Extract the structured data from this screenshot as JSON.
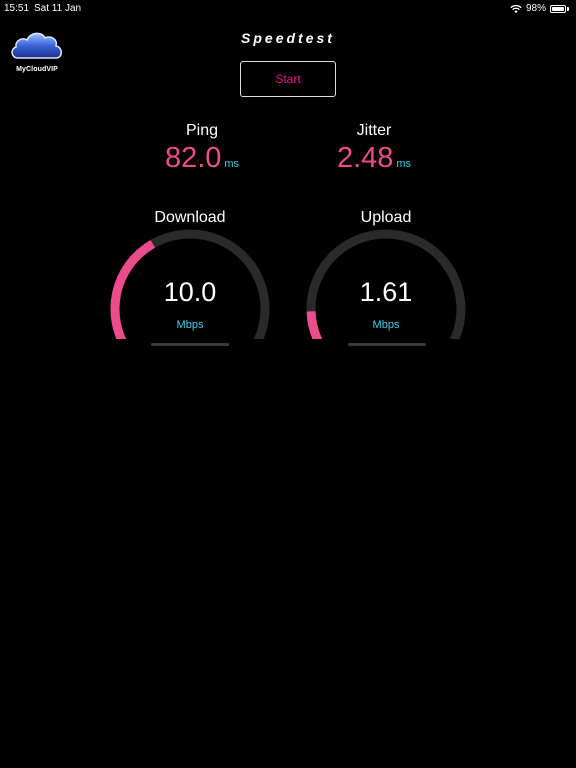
{
  "status_bar": {
    "time": "15:51",
    "date": "Sat 11 Jan",
    "battery": "98%",
    "battery_level": 0.98
  },
  "logo": {
    "text": "MyCloudVIP"
  },
  "app": {
    "title": "Speedtest"
  },
  "controls": {
    "start_label": "Start"
  },
  "metrics": {
    "ping": {
      "label": "Ping",
      "value": "82.0",
      "unit": "ms"
    },
    "jitter": {
      "label": "Jitter",
      "value": "2.48",
      "unit": "ms"
    }
  },
  "gauges": {
    "download": {
      "label": "Download",
      "value": "10.0",
      "unit": "Mbps",
      "fill_fraction": 0.39
    },
    "upload": {
      "label": "Upload",
      "value": "1.61",
      "unit": "Mbps",
      "fill_fraction": 0.16
    }
  },
  "colors": {
    "accent_pink": "#ec4b8c",
    "start_text": "#e6168a",
    "unit_cyan": "#3fd0e6",
    "track": "#2a2a2a"
  }
}
